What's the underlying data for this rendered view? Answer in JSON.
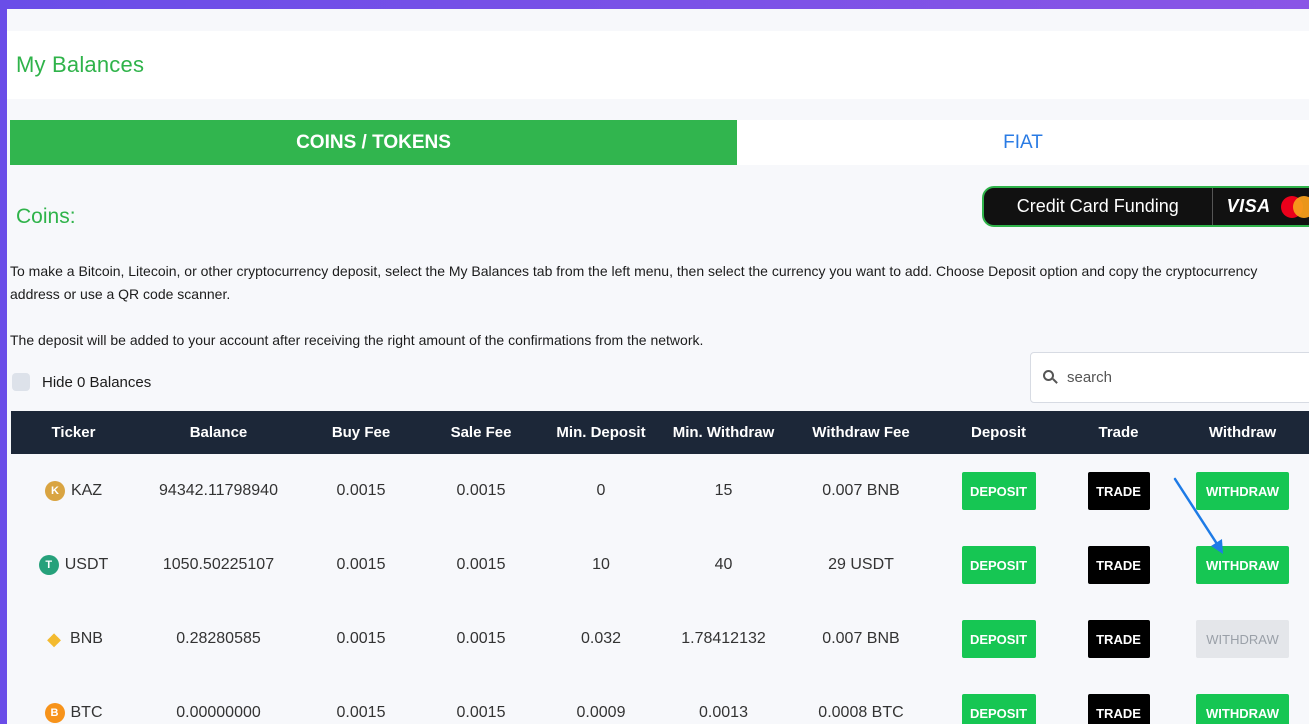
{
  "page": {
    "title": "My Balances"
  },
  "tabs": [
    {
      "label": "COINS / TOKENS",
      "active": true
    },
    {
      "label": "FIAT",
      "active": false
    }
  ],
  "section": {
    "heading": "Coins:",
    "paragraph1": "To make a Bitcoin, Litecoin, or other cryptocurrency deposit, select the My Balances tab from the left menu, then select the currency you want to add. Choose Deposit option and copy the cryptocurrency address or use a QR code scanner.",
    "paragraph2": "The deposit will be added to your account after receiving the right amount of the confirmations from the network."
  },
  "credit_card": {
    "label": "Credit Card Funding",
    "visa": "VISA"
  },
  "filters": {
    "hide_zero_label": "Hide 0 Balances",
    "hide_zero_checked": false
  },
  "search": {
    "placeholder": "search",
    "value": ""
  },
  "table": {
    "headers": [
      "Ticker",
      "Balance",
      "Buy Fee",
      "Sale Fee",
      "Min. Deposit",
      "Min. Withdraw",
      "Withdraw Fee",
      "Deposit",
      "Trade",
      "Withdraw"
    ],
    "rows": [
      {
        "ticker": "KAZ",
        "icon": "kaz-coin-icon",
        "icon_color": "#d9a441",
        "icon_glyph": "K",
        "balance": "94342.11798940",
        "buy_fee": "0.0015",
        "sale_fee": "0.0015",
        "min_deposit": "0",
        "min_withdraw": "15",
        "withdraw_fee": "0.007 BNB",
        "deposit": "DEPOSIT",
        "trade": "TRADE",
        "withdraw": "WITHDRAW",
        "withdraw_enabled": true
      },
      {
        "ticker": "USDT",
        "icon": "usdt-coin-icon",
        "icon_color": "#26a17b",
        "icon_glyph": "T",
        "balance": "1050.50225107",
        "buy_fee": "0.0015",
        "sale_fee": "0.0015",
        "min_deposit": "10",
        "min_withdraw": "40",
        "withdraw_fee": "29 USDT",
        "deposit": "DEPOSIT",
        "trade": "TRADE",
        "withdraw": "WITHDRAW",
        "withdraw_enabled": true
      },
      {
        "ticker": "BNB",
        "icon": "bnb-coin-icon",
        "icon_color": "#f3ba2f",
        "icon_glyph": "◆",
        "balance": "0.28280585",
        "buy_fee": "0.0015",
        "sale_fee": "0.0015",
        "min_deposit": "0.032",
        "min_withdraw": "1.78412132",
        "withdraw_fee": "0.007 BNB",
        "deposit": "DEPOSIT",
        "trade": "TRADE",
        "withdraw": "WITHDRAW",
        "withdraw_enabled": false
      },
      {
        "ticker": "BTC",
        "icon": "btc-coin-icon",
        "icon_color": "#f7931a",
        "icon_glyph": "B",
        "balance": "0.00000000",
        "buy_fee": "0.0015",
        "sale_fee": "0.0015",
        "min_deposit": "0.0009",
        "min_withdraw": "0.0013",
        "withdraw_fee": "0.0008 BTC",
        "deposit": "DEPOSIT",
        "trade": "TRADE",
        "withdraw": "WITHDRAW",
        "withdraw_enabled": true
      }
    ]
  },
  "colors": {
    "brand_green": "#2fb34a",
    "button_green": "#16c653",
    "header_dark": "#1c2738",
    "fiat_blue": "#2a7be4",
    "annotation_arrow": "#1e7be6"
  }
}
